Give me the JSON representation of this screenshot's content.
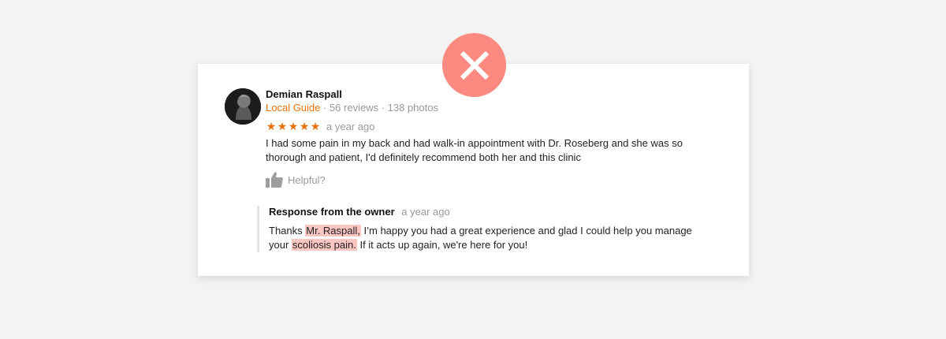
{
  "review": {
    "reviewer_name": "Demian Raspall",
    "badge": "Local Guide",
    "stats": " · 56 reviews · 138 photos",
    "stars": [
      "★",
      "★",
      "★",
      "★",
      "★"
    ],
    "time": "a year ago",
    "text": "I had some pain in my back and had walk-in appointment with Dr. Roseberg and she was so thorough and patient, I'd definitely recommend both her and this clinic",
    "helpful_label": "Helpful?"
  },
  "owner_response": {
    "title": "Response from the owner",
    "time": "a year ago",
    "text_part1": "Thanks ",
    "highlight1": "Mr. Raspall,",
    "text_part2": " I’m happy you had a great experience and glad I could help you manage your ",
    "highlight2": "scoliosis pain.",
    "text_part3": " If it acts up again, we're here for you!"
  },
  "colors": {
    "accent": "#e8710a",
    "badge_red": "#fd8a80",
    "highlight": "#fbc5c1"
  },
  "icons": [
    "close-icon",
    "thumbs-up-icon",
    "avatar"
  ]
}
